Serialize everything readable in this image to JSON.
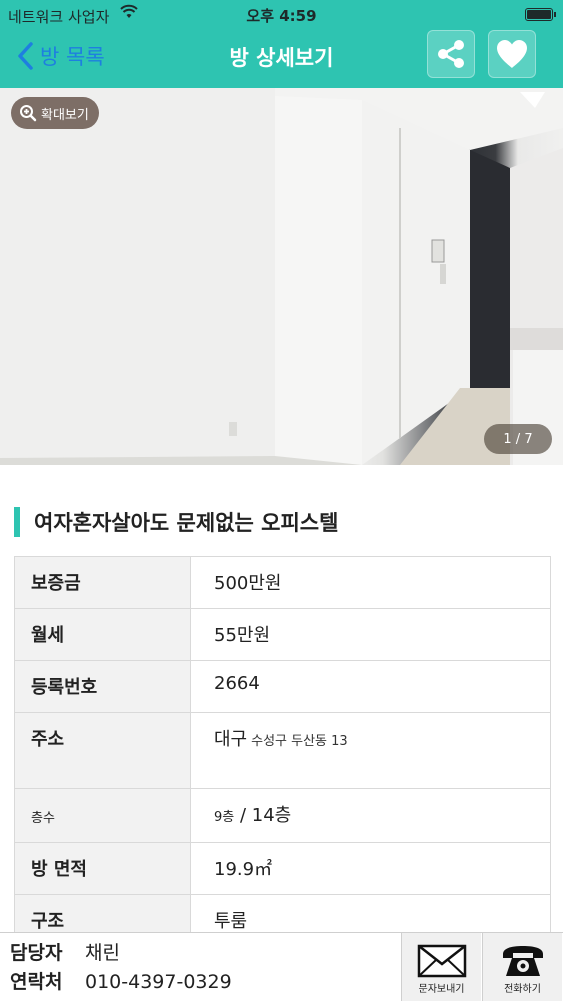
{
  "status_bar": {
    "carrier": "네트워크 사업자",
    "time": "오후 4:59"
  },
  "nav": {
    "back_label": "방 목록",
    "title": "방 상세보기"
  },
  "photo": {
    "zoom_label": "확대보기",
    "counter": "1 / 7"
  },
  "listing": {
    "title": "여자혼자살아도 문제없는 오피스텔"
  },
  "details": [
    {
      "label": "보증금",
      "value": "500만원"
    },
    {
      "label": "월세",
      "value": "55만원"
    },
    {
      "label": "등록번호",
      "value": "2664"
    },
    {
      "label": "주소",
      "value": "대구",
      "sub": "수성구 두산동 13"
    },
    {
      "label": "층수",
      "value_small": "9층",
      "value": "/ 14층"
    },
    {
      "label": "방 면적",
      "value": "19.9㎡"
    },
    {
      "label": "구조",
      "value": "투룸"
    }
  ],
  "contact": {
    "manager_label": "담당자",
    "manager_name": "채린",
    "phone_label": "연락처",
    "phone": "010-4397-0329",
    "sms_label": "문자보내기",
    "call_label": "전화하기"
  },
  "colors": {
    "accent": "#2ec4b1",
    "back_link": "#1e7fe0"
  }
}
